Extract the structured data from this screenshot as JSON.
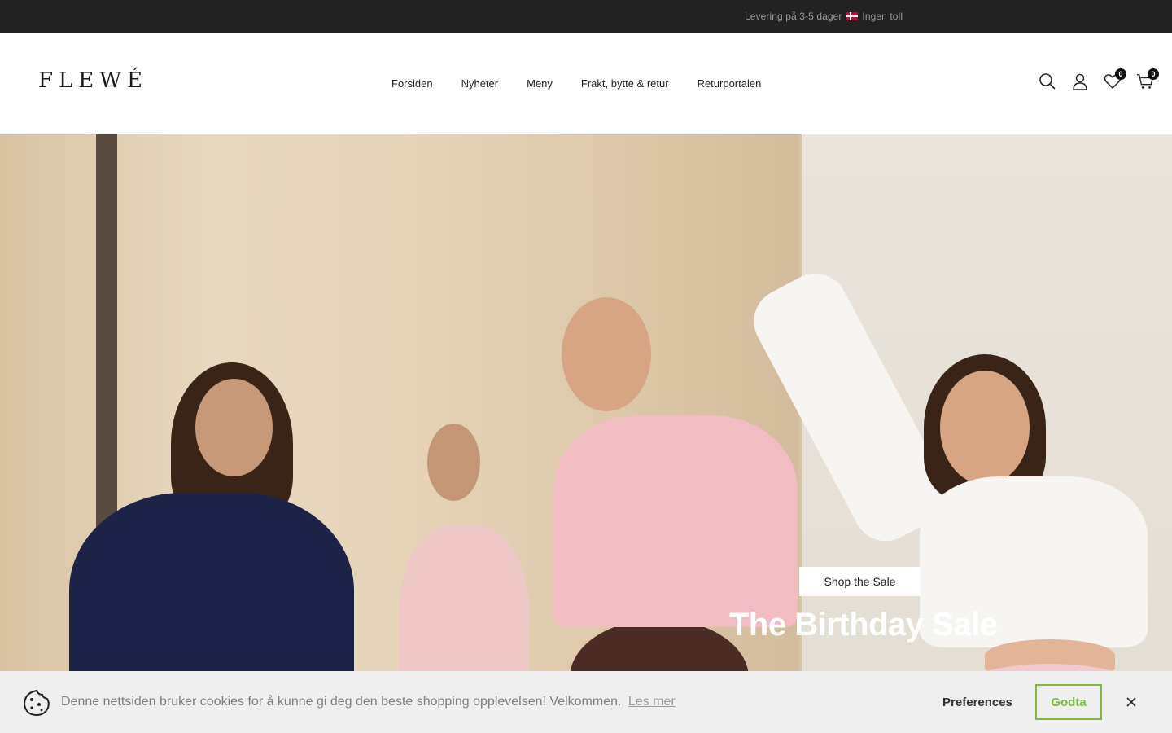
{
  "announcement": {
    "text_before": "Levering på 3-5 dager",
    "flag_icon": "norway-flag-icon",
    "text_after": "Ingen toll"
  },
  "header": {
    "logo": "FLEWÉ",
    "nav": [
      "Forsiden",
      "Nyheter",
      "Meny",
      "Frakt, bytte & retur",
      "Returportalen"
    ],
    "wishlist_count": "0",
    "cart_count": "0"
  },
  "hero": {
    "button_label": "Shop the Sale",
    "title": "The Birthday Sale"
  },
  "cookie_banner": {
    "text": "Denne nettsiden bruker cookies for å kunne gi deg den beste shopping opplevelsen! Velkommen.",
    "link_label": "Les mer",
    "preferences_label": "Preferences",
    "accept_label": "Godta",
    "accent_color": "#7cba3f"
  },
  "colors": {
    "announcement_bg": "#222222",
    "announcement_text": "#9b9b9b"
  }
}
